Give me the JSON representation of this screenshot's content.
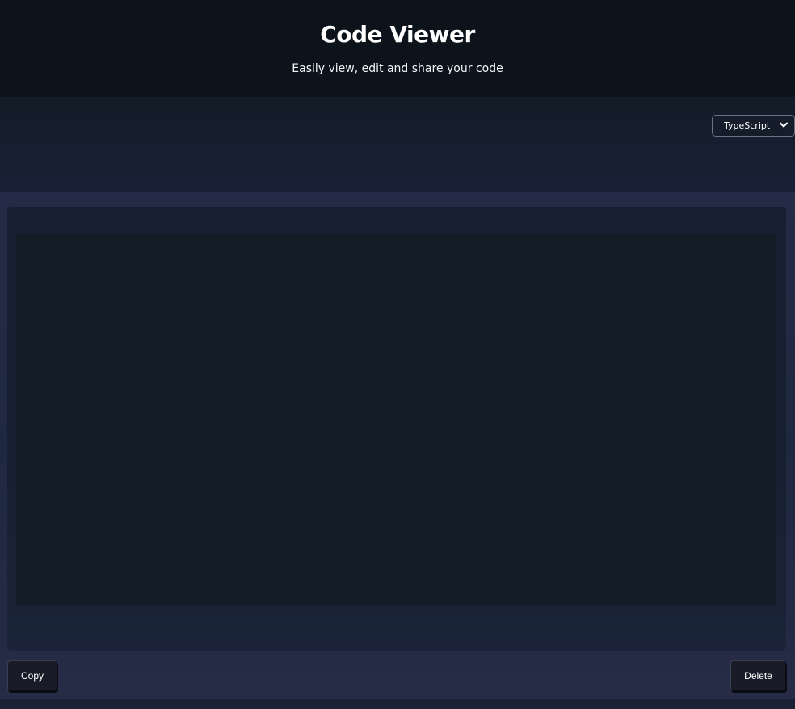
{
  "header": {
    "title": "Code Viewer",
    "subtitle": "Easily view, edit and share your code"
  },
  "toolbar": {
    "language_select": {
      "selected": "TypeScript",
      "icon": "chevron-down-icon"
    }
  },
  "editor": {
    "code": ""
  },
  "actions": {
    "copy_label": "Copy",
    "delete_label": "Delete"
  },
  "colors": {
    "header_bg": "#0d131b",
    "editor_bg": "#141d27",
    "button_bg": "#1a1b29"
  }
}
